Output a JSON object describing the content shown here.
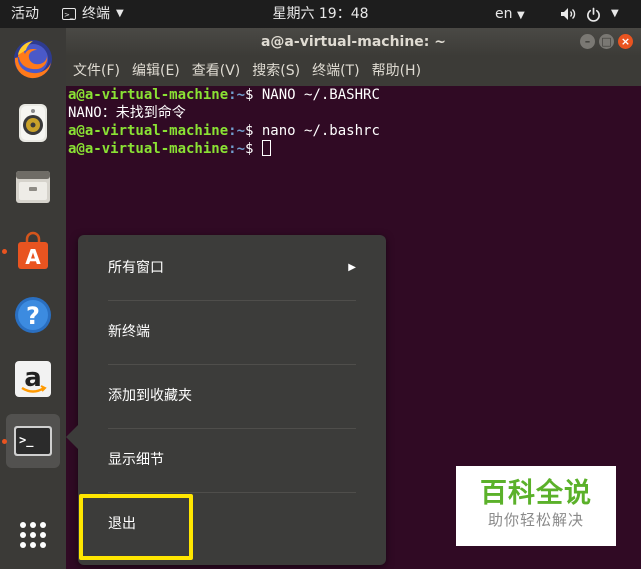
{
  "top_panel": {
    "activities": "活动",
    "app_name": "终端",
    "app_icon_text": ">_",
    "clock": "星期六 19：48",
    "lang": "en"
  },
  "dock": {
    "items": [
      {
        "name": "firefox",
        "icon": "firefox-icon"
      },
      {
        "name": "rhythmbox",
        "icon": "speaker-icon"
      },
      {
        "name": "files",
        "icon": "file-cabinet-icon"
      },
      {
        "name": "software",
        "icon": "shopping-bag-icon",
        "text": "A"
      },
      {
        "name": "help",
        "icon": "help-icon",
        "text": "?"
      },
      {
        "name": "amazon",
        "icon": "amazon-icon",
        "text": "a"
      },
      {
        "name": "terminal",
        "icon": "terminal-icon",
        "text": ">_"
      },
      {
        "name": "show-apps",
        "icon": "grid-icon"
      }
    ]
  },
  "terminal": {
    "title": "a@a-virtual-machine: ~",
    "menu": [
      "文件(F)",
      "编辑(E)",
      "查看(V)",
      "搜索(S)",
      "终端(T)",
      "帮助(H)"
    ],
    "prompt_user": "a@a-virtual-machine",
    "prompt_path": ":~",
    "prompt_symbol": "$ ",
    "lines": {
      "l1_cmd": "NANO ~/.BASHRC",
      "l2_out": "NANO：未找到命令",
      "l3_cmd": "nano ~/.bashrc"
    }
  },
  "context_menu": {
    "items": [
      "所有窗口",
      "新终端",
      "添加到收藏夹",
      "显示细节",
      "退出"
    ],
    "submenu_arrow": "▶"
  },
  "watermark": {
    "title": "百科全说",
    "subtitle": "助你轻松解决"
  },
  "colors": {
    "terminal_bg": "#300a24",
    "prompt_user": "#8ae234",
    "prompt_path": "#729fcf",
    "highlight": "#ffe600",
    "accent": "#e95420"
  }
}
